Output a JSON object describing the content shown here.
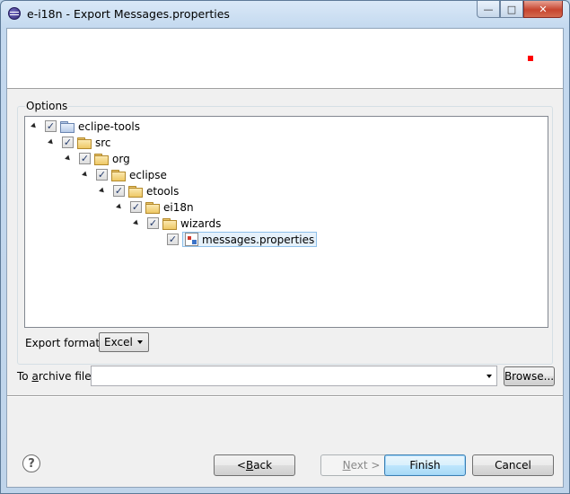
{
  "window": {
    "title": "e-i18n - Export Messages.properties",
    "icon": "eclipse-icon",
    "controls": {
      "minimize": "—",
      "maximize": "□",
      "close": "✕"
    }
  },
  "options": {
    "label": "Options",
    "tree": [
      {
        "label": "eclipe-tools",
        "icon": "project-folder-icon",
        "checked": true
      },
      {
        "label": "src",
        "icon": "folder-icon",
        "checked": true
      },
      {
        "label": "org",
        "icon": "folder-icon",
        "checked": true
      },
      {
        "label": "eclipse",
        "icon": "folder-icon",
        "checked": true
      },
      {
        "label": "etools",
        "icon": "folder-icon",
        "checked": true
      },
      {
        "label": "ei18n",
        "icon": "folder-icon",
        "checked": true
      },
      {
        "label": "wizards",
        "icon": "folder-icon",
        "checked": true
      },
      {
        "label": "messages.properties",
        "icon": "properties-file-icon",
        "checked": true,
        "selected": true
      }
    ],
    "export_format": {
      "label": "Export format:",
      "value": "Excel"
    }
  },
  "archive": {
    "label_prefix": "To ",
    "label_mnemonic": "a",
    "label_suffix": "rchive file:",
    "value": "",
    "browse_label": "Browse..."
  },
  "buttons": {
    "help": "?",
    "back_prefix": "< ",
    "back_mnemonic": "B",
    "back_suffix": "ack",
    "next_prefix": "",
    "next_mnemonic": "N",
    "next_suffix": "ext >",
    "finish": "Finish",
    "cancel": "Cancel"
  },
  "colors": {
    "selection": "#e5f1fb",
    "marker": "#ff0000",
    "check": "#233a6b"
  }
}
